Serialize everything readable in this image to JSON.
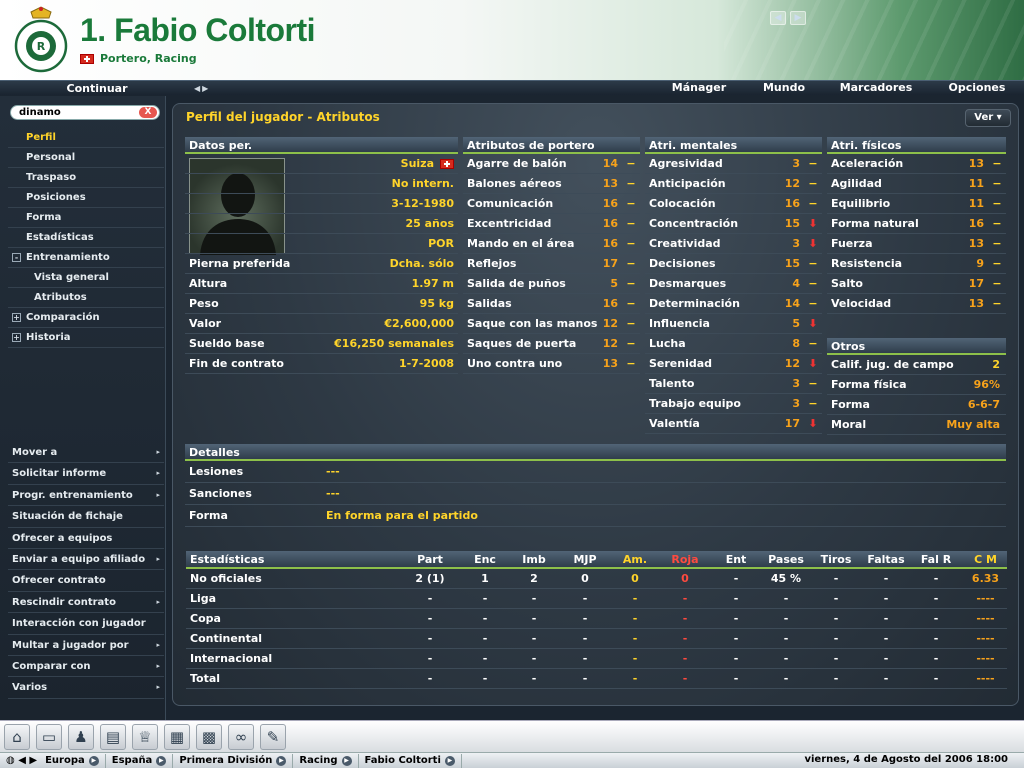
{
  "header": {
    "name": "1. Fabio Coltorti",
    "subtitle": "Portero, Racing",
    "crest_text": "REAL RACING CLUB SANTANDER"
  },
  "menubar": {
    "continue": "Continuar",
    "items": [
      "Mánager",
      "Mundo",
      "Marcadores",
      "Opciones"
    ]
  },
  "sidebar": {
    "search_value": "dinamo",
    "clear": "X",
    "nav": [
      {
        "label": "Perfil",
        "active": true
      },
      {
        "label": "Personal"
      },
      {
        "label": "Traspaso"
      },
      {
        "label": "Posiciones"
      },
      {
        "label": "Forma"
      },
      {
        "label": "Estadísticas"
      },
      {
        "label": "Entrenamiento",
        "expand": "-"
      },
      {
        "label": "Vista general",
        "sub": true
      },
      {
        "label": "Atributos",
        "sub": true
      },
      {
        "label": "Comparación",
        "expand": "+"
      },
      {
        "label": "Historia",
        "expand": "+"
      }
    ],
    "actions": [
      {
        "label": "Mover a",
        "more": true
      },
      {
        "label": "Solicitar informe",
        "more": true
      },
      {
        "label": "Progr. entrenamiento",
        "more": true
      },
      {
        "label": "Situación de fichaje",
        "more": false
      },
      {
        "label": "Ofrecer a equipos",
        "more": false
      },
      {
        "label": "Enviar a equipo afiliado",
        "more": true
      },
      {
        "label": "Ofrecer contrato",
        "more": false
      },
      {
        "label": "Rescindir contrato",
        "more": true
      },
      {
        "label": "Interacción con jugador",
        "more": false
      },
      {
        "label": "Multar a jugador por",
        "more": true
      },
      {
        "label": "Comparar con",
        "more": true
      },
      {
        "label": "Varios",
        "more": true
      }
    ]
  },
  "main": {
    "title": "Perfil del jugador - Atributos",
    "view_button": "Ver"
  },
  "personal": {
    "header": "Datos per.",
    "top_values": [
      "Suiza",
      "No intern.",
      "3-12-1980",
      "25 años",
      "POR"
    ],
    "rows": [
      {
        "label": "Pierna preferida",
        "value": "Dcha. sólo"
      },
      {
        "label": "Altura",
        "value": "1.97 m"
      },
      {
        "label": "Peso",
        "value": "95 kg"
      },
      {
        "label": "Valor",
        "value": "€2,600,000"
      },
      {
        "label": "Sueldo base",
        "value": "€16,250 semanales"
      },
      {
        "label": "Fin de contrato",
        "value": "1-7-2008"
      }
    ]
  },
  "goalkeeper": {
    "header": "Atributos de portero",
    "rows": [
      {
        "label": "Agarre de balón",
        "value": "14",
        "trend": "−"
      },
      {
        "label": "Balones aéreos",
        "value": "13",
        "trend": "−"
      },
      {
        "label": "Comunicación",
        "value": "16",
        "trend": "−"
      },
      {
        "label": "Excentricidad",
        "value": "16",
        "trend": "−"
      },
      {
        "label": "Mando en el área",
        "value": "16",
        "trend": "−"
      },
      {
        "label": "Reflejos",
        "value": "17",
        "trend": "−"
      },
      {
        "label": "Salida de puños",
        "value": "5",
        "trend": "−"
      },
      {
        "label": "Salidas",
        "value": "16",
        "trend": "−"
      },
      {
        "label": "Saque con las manos",
        "value": "12",
        "trend": "−"
      },
      {
        "label": "Saques de puerta",
        "value": "12",
        "trend": "−"
      },
      {
        "label": "Uno contra uno",
        "value": "13",
        "trend": "−"
      }
    ]
  },
  "mental": {
    "header": "Atri. mentales",
    "rows": [
      {
        "label": "Agresividad",
        "value": "3",
        "trend": "−"
      },
      {
        "label": "Anticipación",
        "value": "12",
        "trend": "−"
      },
      {
        "label": "Colocación",
        "value": "16",
        "trend": "−"
      },
      {
        "label": "Concentración",
        "value": "15",
        "trend": "⬇",
        "down": true
      },
      {
        "label": "Creatividad",
        "value": "3",
        "trend": "⬇",
        "down": true
      },
      {
        "label": "Decisiones",
        "value": "15",
        "trend": "−"
      },
      {
        "label": "Desmarques",
        "value": "4",
        "trend": "−"
      },
      {
        "label": "Determinación",
        "value": "14",
        "trend": "−"
      },
      {
        "label": "Influencia",
        "value": "5",
        "trend": "⬇",
        "down": true
      },
      {
        "label": "Lucha",
        "value": "8",
        "trend": "−"
      },
      {
        "label": "Serenidad",
        "value": "12",
        "trend": "⬇",
        "down": true
      },
      {
        "label": "Talento",
        "value": "3",
        "trend": "−"
      },
      {
        "label": "Trabajo equipo",
        "value": "3",
        "trend": "−"
      },
      {
        "label": "Valentía",
        "value": "17",
        "trend": "⬇",
        "down": true
      }
    ]
  },
  "physical": {
    "header": "Atri. físicos",
    "rows": [
      {
        "label": "Aceleración",
        "value": "13",
        "trend": "−"
      },
      {
        "label": "Agilidad",
        "value": "11",
        "trend": "−"
      },
      {
        "label": "Equilibrio",
        "value": "11",
        "trend": "−"
      },
      {
        "label": "Forma natural",
        "value": "16",
        "trend": "−"
      },
      {
        "label": "Fuerza",
        "value": "13",
        "trend": "−"
      },
      {
        "label": "Resistencia",
        "value": "9",
        "trend": "−"
      },
      {
        "label": "Salto",
        "value": "17",
        "trend": "−"
      },
      {
        "label": "Velocidad",
        "value": "13",
        "trend": "−"
      }
    ]
  },
  "others": {
    "header": "Otros",
    "rows": [
      {
        "label": "Calif. jug. de campo",
        "value": "2"
      },
      {
        "label": "Forma física",
        "value": "96%"
      },
      {
        "label": "Forma",
        "value": "6-6-7"
      },
      {
        "label": "Moral",
        "value": "Muy alta"
      }
    ]
  },
  "details": {
    "header": "Detalles",
    "rows": [
      {
        "label": "Lesiones",
        "value": "---"
      },
      {
        "label": "Sanciones",
        "value": "---"
      },
      {
        "label": "Forma",
        "value": "En forma para el partido"
      }
    ]
  },
  "stats": {
    "columns": [
      "Estadísticas",
      "Part",
      "Enc",
      "Imb",
      "MJP",
      "Am.",
      "Roja",
      "Ent",
      "Pases",
      "Tiros",
      "Faltas",
      "Fal R",
      "C M"
    ],
    "rows": [
      [
        "No oficiales",
        "2 (1)",
        "1",
        "2",
        "0",
        "0",
        "0",
        "-",
        "45 %",
        "-",
        "-",
        "-",
        "6.33"
      ],
      [
        "Liga",
        "-",
        "-",
        "-",
        "-",
        "-",
        "-",
        "-",
        "-",
        "-",
        "-",
        "-",
        "----"
      ],
      [
        "Copa",
        "-",
        "-",
        "-",
        "-",
        "-",
        "-",
        "-",
        "-",
        "-",
        "-",
        "-",
        "----"
      ],
      [
        "Continental",
        "-",
        "-",
        "-",
        "-",
        "-",
        "-",
        "-",
        "-",
        "-",
        "-",
        "-",
        "----"
      ],
      [
        "Internacional",
        "-",
        "-",
        "-",
        "-",
        "-",
        "-",
        "-",
        "-",
        "-",
        "-",
        "-",
        "----"
      ],
      [
        "Total",
        "-",
        "-",
        "-",
        "-",
        "-",
        "-",
        "-",
        "-",
        "-",
        "-",
        "-",
        "----"
      ]
    ]
  },
  "dock": {
    "icons": [
      "home-icon",
      "inbox-icon",
      "squad-icon",
      "printer-icon",
      "trophy-icon",
      "clipboard-icon",
      "pitch-icon",
      "binoculars-icon",
      "notepad-icon"
    ],
    "glyphs": [
      "⌂",
      "▭",
      "♟",
      "▤",
      "♕",
      "▦",
      "▩",
      "∞",
      "✎"
    ]
  },
  "status": {
    "crumbs": [
      "Europa",
      "España",
      "Primera División",
      "Racing",
      "Fabio Coltorti"
    ],
    "date": "viernes, 4 de Agosto del 2006 18:00"
  }
}
